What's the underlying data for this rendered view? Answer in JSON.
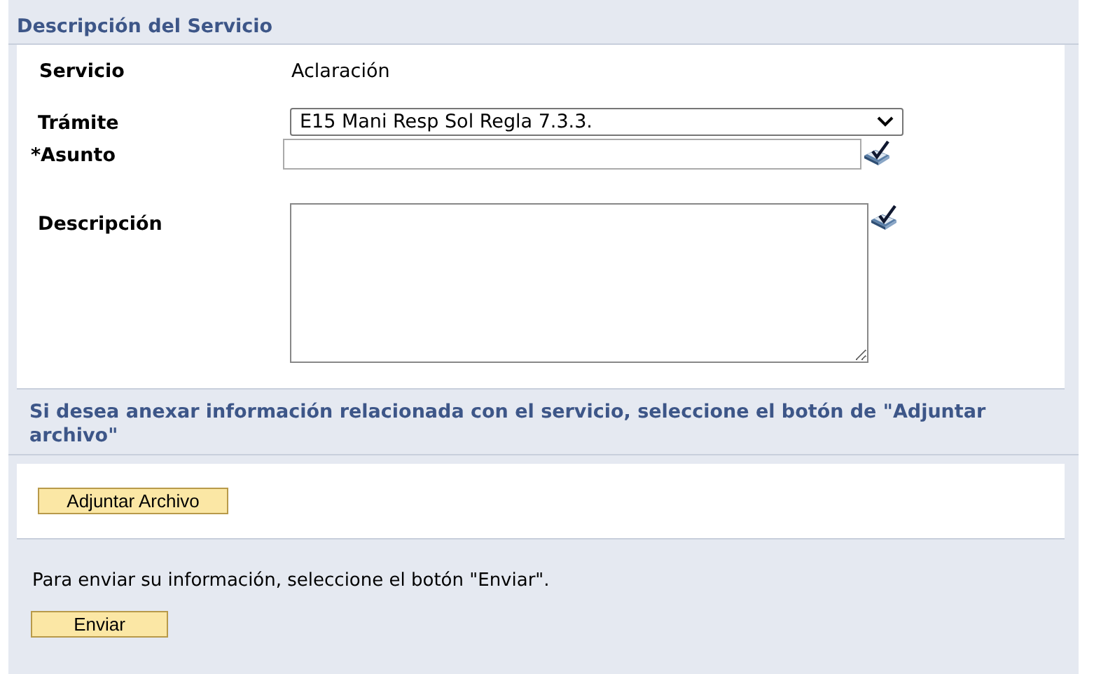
{
  "section_title": "Descripción del Servicio",
  "fields": [
    {
      "kind": "text",
      "label": "Servicio",
      "value": "Aclaración"
    },
    {
      "kind": "select",
      "label": "Trámite",
      "value": "E15 Mani Resp Sol Regla 7.3.3."
    },
    {
      "kind": "input",
      "label": "*Asunto",
      "spellcheck": true
    },
    {
      "kind": "textarea",
      "label": "Descripción",
      "spellcheck": true
    }
  ],
  "attach_prompt": "Si desea anexar información relacionada con el servicio, seleccione el botón de \"Adjuntar archivo\"",
  "attach_button": "Adjuntar Archivo",
  "send_prompt": "Para enviar su información, seleccione el botón \"Enviar\".",
  "send_button": "Enviar"
}
